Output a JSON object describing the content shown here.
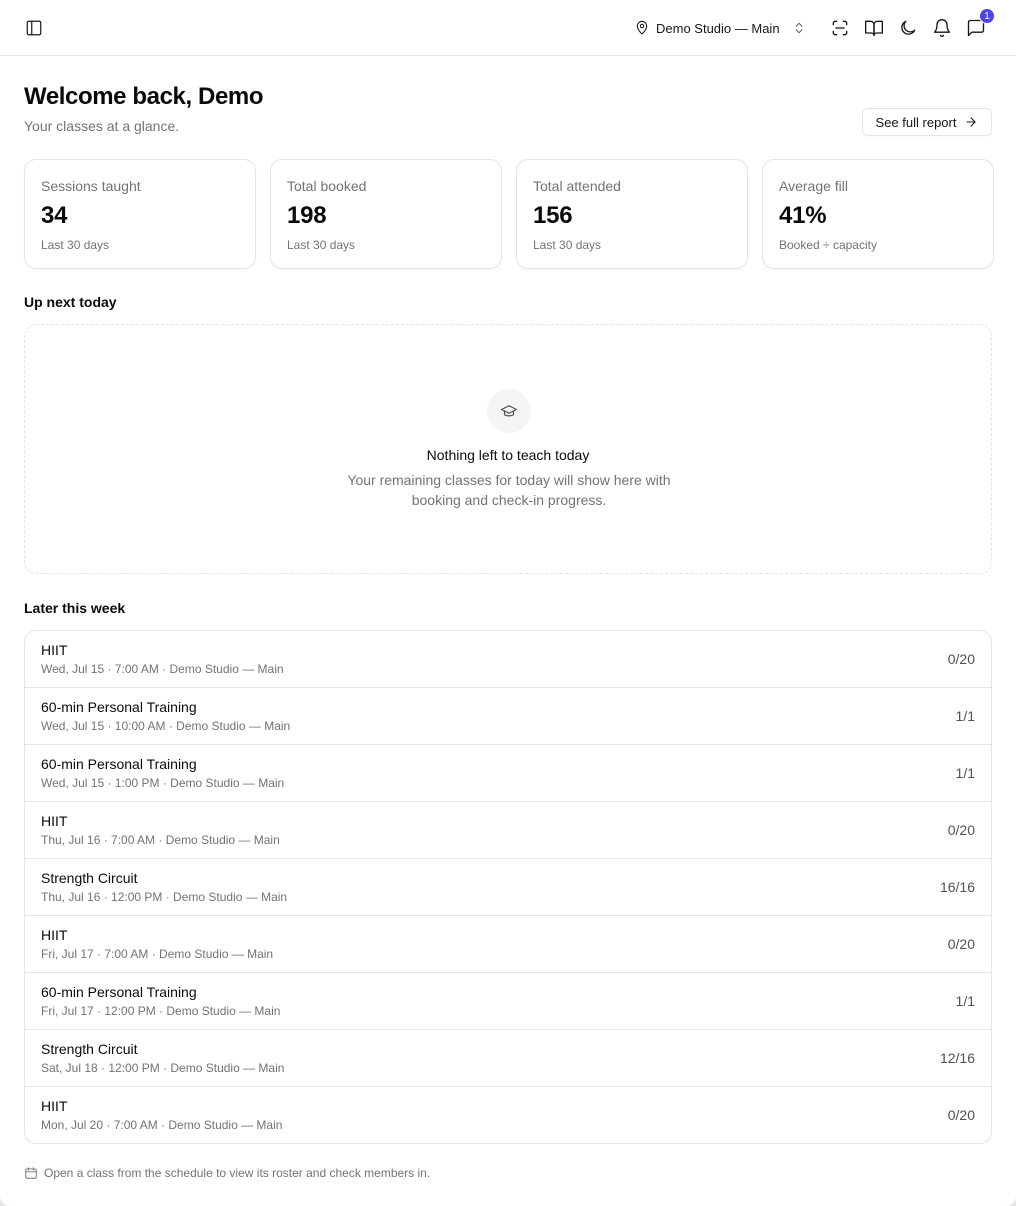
{
  "header": {
    "sidebar_toggle_icon": "sidebar-toggle-icon",
    "location": "Demo Studio — Main",
    "actions": [
      {
        "icon": "scan-icon"
      },
      {
        "icon": "book-open-icon"
      },
      {
        "icon": "moon-icon"
      },
      {
        "icon": "bell-icon"
      },
      {
        "icon": "message-icon",
        "badge": "1"
      }
    ],
    "accent_color": "#4f46e5"
  },
  "page": {
    "title": "Welcome back, Demo",
    "subtitle": "Your classes at a glance.",
    "report_button": "See full report"
  },
  "stats": [
    {
      "label": "Sessions taught",
      "value": "34",
      "note": "Last 30 days"
    },
    {
      "label": "Total booked",
      "value": "198",
      "note": "Last 30 days"
    },
    {
      "label": "Total attended",
      "value": "156",
      "note": "Last 30 days"
    },
    {
      "label": "Average fill",
      "value": "41%",
      "note": "Booked ÷ capacity"
    }
  ],
  "up_next": {
    "heading": "Up next today",
    "empty_icon": "graduation-cap-icon",
    "empty_title": "Nothing left to teach today",
    "empty_body": "Your remaining classes for today will show here with booking and check-in progress."
  },
  "later": {
    "heading": "Later this week",
    "classes": [
      {
        "name": "HIIT",
        "details": "Wed, Jul 15 · 7:00 AM · Demo Studio — Main",
        "booked": "0/20"
      },
      {
        "name": "60-min Personal Training",
        "details": "Wed, Jul 15 · 10:00 AM · Demo Studio — Main",
        "booked": "1/1"
      },
      {
        "name": "60-min Personal Training",
        "details": "Wed, Jul 15 · 1:00 PM · Demo Studio — Main",
        "booked": "1/1"
      },
      {
        "name": "HIIT",
        "details": "Thu, Jul 16 · 7:00 AM · Demo Studio — Main",
        "booked": "0/20"
      },
      {
        "name": "Strength Circuit",
        "details": "Thu, Jul 16 · 12:00 PM · Demo Studio — Main",
        "booked": "16/16"
      },
      {
        "name": "HIIT",
        "details": "Fri, Jul 17 · 7:00 AM · Demo Studio — Main",
        "booked": "0/20"
      },
      {
        "name": "60-min Personal Training",
        "details": "Fri, Jul 17 · 12:00 PM · Demo Studio — Main",
        "booked": "1/1"
      },
      {
        "name": "Strength Circuit",
        "details": "Sat, Jul 18 · 12:00 PM · Demo Studio — Main",
        "booked": "12/16"
      },
      {
        "name": "HIIT",
        "details": "Mon, Jul 20 · 7:00 AM · Demo Studio — Main",
        "booked": "0/20"
      }
    ]
  },
  "footer": {
    "icon": "calendar-icon",
    "note": "Open a class from the schedule to view its roster and check members in."
  }
}
